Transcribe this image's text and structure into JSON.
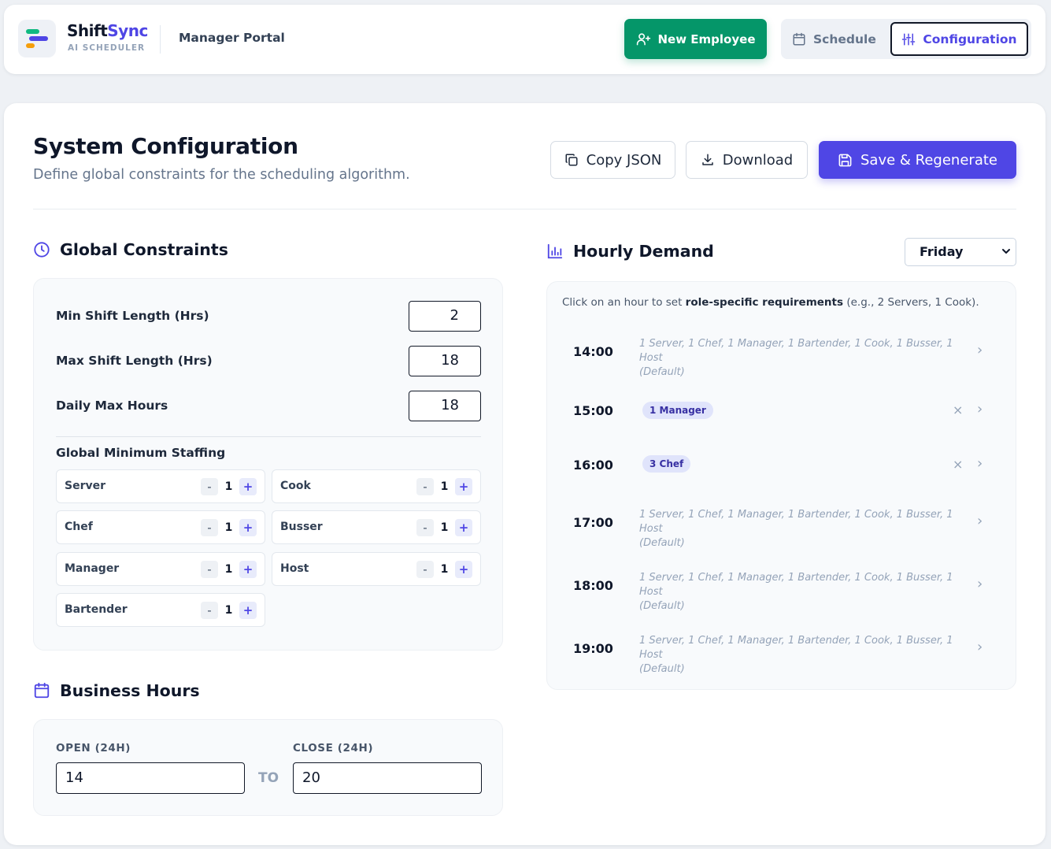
{
  "header": {
    "brand_primary": "Shift",
    "brand_accent": "Sync",
    "brand_sub": "AI SCHEDULER",
    "portal": "Manager Portal",
    "new_employee": "New Employee",
    "nav_schedule": "Schedule",
    "nav_configuration": "Configuration"
  },
  "page": {
    "title": "System Configuration",
    "subtitle": "Define global constraints for the scheduling algorithm.",
    "copy_json": "Copy JSON",
    "download": "Download",
    "save": "Save & Regenerate"
  },
  "constraints": {
    "title": "Global Constraints",
    "min_shift_label": "Min Shift Length (Hrs)",
    "min_shift_value": "2",
    "max_shift_label": "Max Shift Length (Hrs)",
    "max_shift_value": "18",
    "daily_max_label": "Daily Max Hours",
    "daily_max_value": "18",
    "staffing_title": "Global Minimum Staffing",
    "minus": "-",
    "plus": "+",
    "roles": [
      {
        "name": "Server",
        "value": "1"
      },
      {
        "name": "Cook",
        "value": "1"
      },
      {
        "name": "Chef",
        "value": "1"
      },
      {
        "name": "Busser",
        "value": "1"
      },
      {
        "name": "Manager",
        "value": "1"
      },
      {
        "name": "Host",
        "value": "1"
      },
      {
        "name": "Bartender",
        "value": "1"
      }
    ]
  },
  "business_hours": {
    "title": "Business Hours",
    "open_label": "OPEN (24H)",
    "open_value": "14",
    "to_label": "TO",
    "close_label": "CLOSE (24H)",
    "close_value": "20"
  },
  "demand": {
    "title": "Hourly Demand",
    "day": "Friday",
    "hint_pre": "Click on an hour to set ",
    "hint_bold": "role-specific requirements",
    "hint_post": " (e.g., 2 Servers, 1 Cook).",
    "rows": [
      {
        "time": "14:00",
        "line1": "1 Server, 1 Chef, 1 Manager, 1 Bartender, 1 Cook, 1 Busser, 1 Host",
        "line2": "(Default)"
      },
      {
        "time": "15:00",
        "pill": "1 Manager"
      },
      {
        "time": "16:00",
        "pill": "3 Chef"
      },
      {
        "time": "17:00",
        "line1": "1 Server, 1 Chef, 1 Manager, 1 Bartender, 1 Cook, 1 Busser, 1 Host",
        "line2": "(Default)"
      },
      {
        "time": "18:00",
        "line1": "1 Server, 1 Chef, 1 Manager, 1 Bartender, 1 Cook, 1 Busser, 1 Host",
        "line2": "(Default)"
      },
      {
        "time": "19:00",
        "line1": "1 Server, 1 Chef, 1 Manager, 1 Bartender, 1 Cook, 1 Busser, 1 Host",
        "line2": "(Default)"
      }
    ],
    "remove_glyph": "×",
    "chevron_glyph": "›"
  },
  "colors": {
    "accent": "#4f46e5",
    "success": "#059669",
    "logo_green": "#10b981",
    "logo_indigo": "#4f46e5",
    "logo_amber": "#f59e0b"
  }
}
